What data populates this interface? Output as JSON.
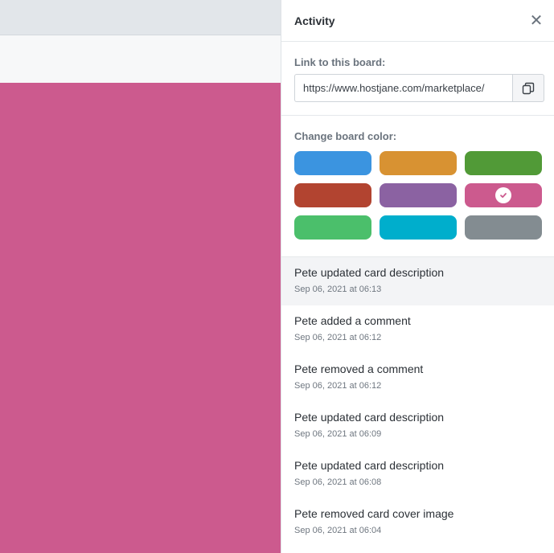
{
  "panel": {
    "title": "Activity",
    "close_icon": "close-icon"
  },
  "link": {
    "label": "Link to this board:",
    "url": "https://www.hostjane.com/marketplace/",
    "copy_icon": "copy-icon"
  },
  "colors": {
    "label": "Change board color:",
    "swatches": [
      {
        "name": "blue",
        "hex": "#3b94e0",
        "selected": false
      },
      {
        "name": "orange",
        "hex": "#d89232",
        "selected": false
      },
      {
        "name": "green",
        "hex": "#519a37",
        "selected": false
      },
      {
        "name": "red",
        "hex": "#b24430",
        "selected": false
      },
      {
        "name": "purple",
        "hex": "#8b62a2",
        "selected": false
      },
      {
        "name": "pink",
        "hex": "#cc5a8e",
        "selected": true
      },
      {
        "name": "light-green",
        "hex": "#4bbf6b",
        "selected": false
      },
      {
        "name": "sky",
        "hex": "#00aecc",
        "selected": false
      },
      {
        "name": "grey",
        "hex": "#838c91",
        "selected": false
      }
    ]
  },
  "activity": [
    {
      "text": "Pete updated card description",
      "time": "Sep 06, 2021 at 06:13"
    },
    {
      "text": "Pete added a comment",
      "time": "Sep 06, 2021 at 06:12"
    },
    {
      "text": "Pete removed a comment",
      "time": "Sep 06, 2021 at 06:12"
    },
    {
      "text": "Pete updated card description",
      "time": "Sep 06, 2021 at 06:09"
    },
    {
      "text": "Pete updated card description",
      "time": "Sep 06, 2021 at 06:08"
    },
    {
      "text": "Pete removed card cover image",
      "time": "Sep 06, 2021 at 06:04"
    }
  ],
  "board": {
    "background_color": "#cc5a8e"
  }
}
